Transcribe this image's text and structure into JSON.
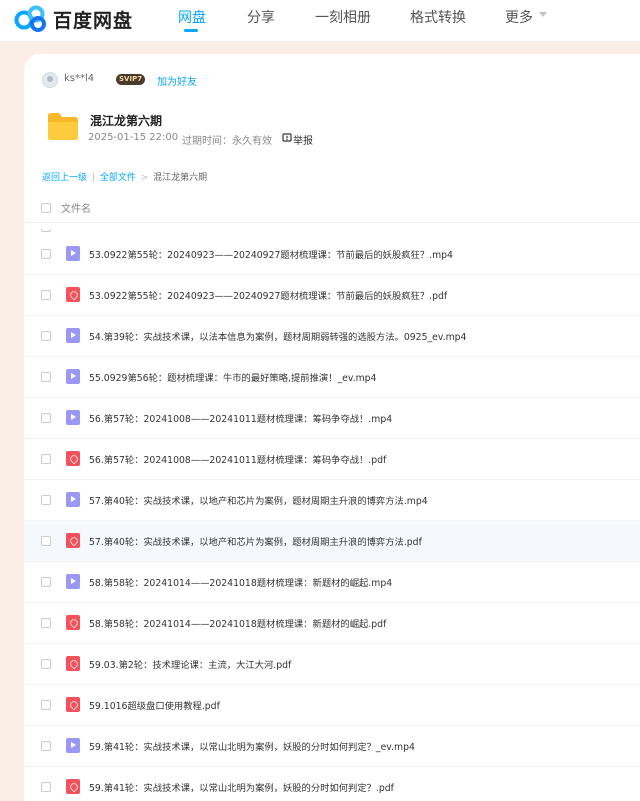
{
  "app": {
    "logo_text": "百度网盘"
  },
  "nav": {
    "items": [
      {
        "label": "网盘",
        "active": true
      },
      {
        "label": "分享"
      },
      {
        "label": "一刻相册"
      },
      {
        "label": "格式转换"
      },
      {
        "label": "更多"
      }
    ]
  },
  "share": {
    "username": "ks**l4",
    "vip_badge": "SVIP7",
    "add_friend": "加为好友",
    "folder_title": "混江龙第六期",
    "date": "2025-01-15 22:00",
    "expiry": "过期时间：永久有效",
    "report": "举报"
  },
  "breadcrumb": {
    "back": "返回上一级",
    "divider": "|",
    "all_files": "全部文件",
    "sep": ">",
    "current": "混江龙第六期"
  },
  "table": {
    "column_filename": "文件名",
    "rows": [
      {
        "type": "video",
        "name": "53.0922第55轮：20240923——20240927题材梳理课：节前最后的妖股疯狂？.mp4"
      },
      {
        "type": "pdf",
        "name": "53.0922第55轮：20240923——20240927题材梳理课：节前最后的妖股疯狂？.pdf"
      },
      {
        "type": "video",
        "name": "54.第39轮：实战技术课，以法本信息为案例，题材周期弱转强的选股方法。0925_ev.mp4"
      },
      {
        "type": "video",
        "name": "55.0929第56轮：题材梳理课：牛市的最好策略,提前推演！_ev.mp4"
      },
      {
        "type": "video",
        "name": "56.第57轮：20241008——20241011题材梳理课：筹码争夺战！.mp4"
      },
      {
        "type": "pdf",
        "name": "56.第57轮：20241008——20241011题材梳理课：筹码争夺战！.pdf"
      },
      {
        "type": "video",
        "name": "57.第40轮：实战技术课，以地产和芯片为案例，题材周期主升浪的博弈方法.mp4"
      },
      {
        "type": "pdf",
        "name": "57.第40轮：实战技术课，以地产和芯片为案例，题材周期主升浪的博弈方法.pdf",
        "highlight": true
      },
      {
        "type": "video",
        "name": "58.第58轮：20241014——20241018题材梳理课：新题材的崛起.mp4"
      },
      {
        "type": "pdf",
        "name": "58.第58轮：20241014——20241018题材梳理课：新题材的崛起.pdf"
      },
      {
        "type": "pdf",
        "name": "59.03.第2轮：技术理论课：主流，大江大河.pdf"
      },
      {
        "type": "pdf",
        "name": "59.1016超级盘口使用教程.pdf"
      },
      {
        "type": "video",
        "name": "59.第41轮：实战技术课，以常山北明为案例，妖股的分时如何判定？_ev.mp4"
      },
      {
        "type": "pdf",
        "name": "59.第41轮：实战技术课，以常山北明为案例，妖股的分时如何判定？.pdf"
      }
    ]
  }
}
